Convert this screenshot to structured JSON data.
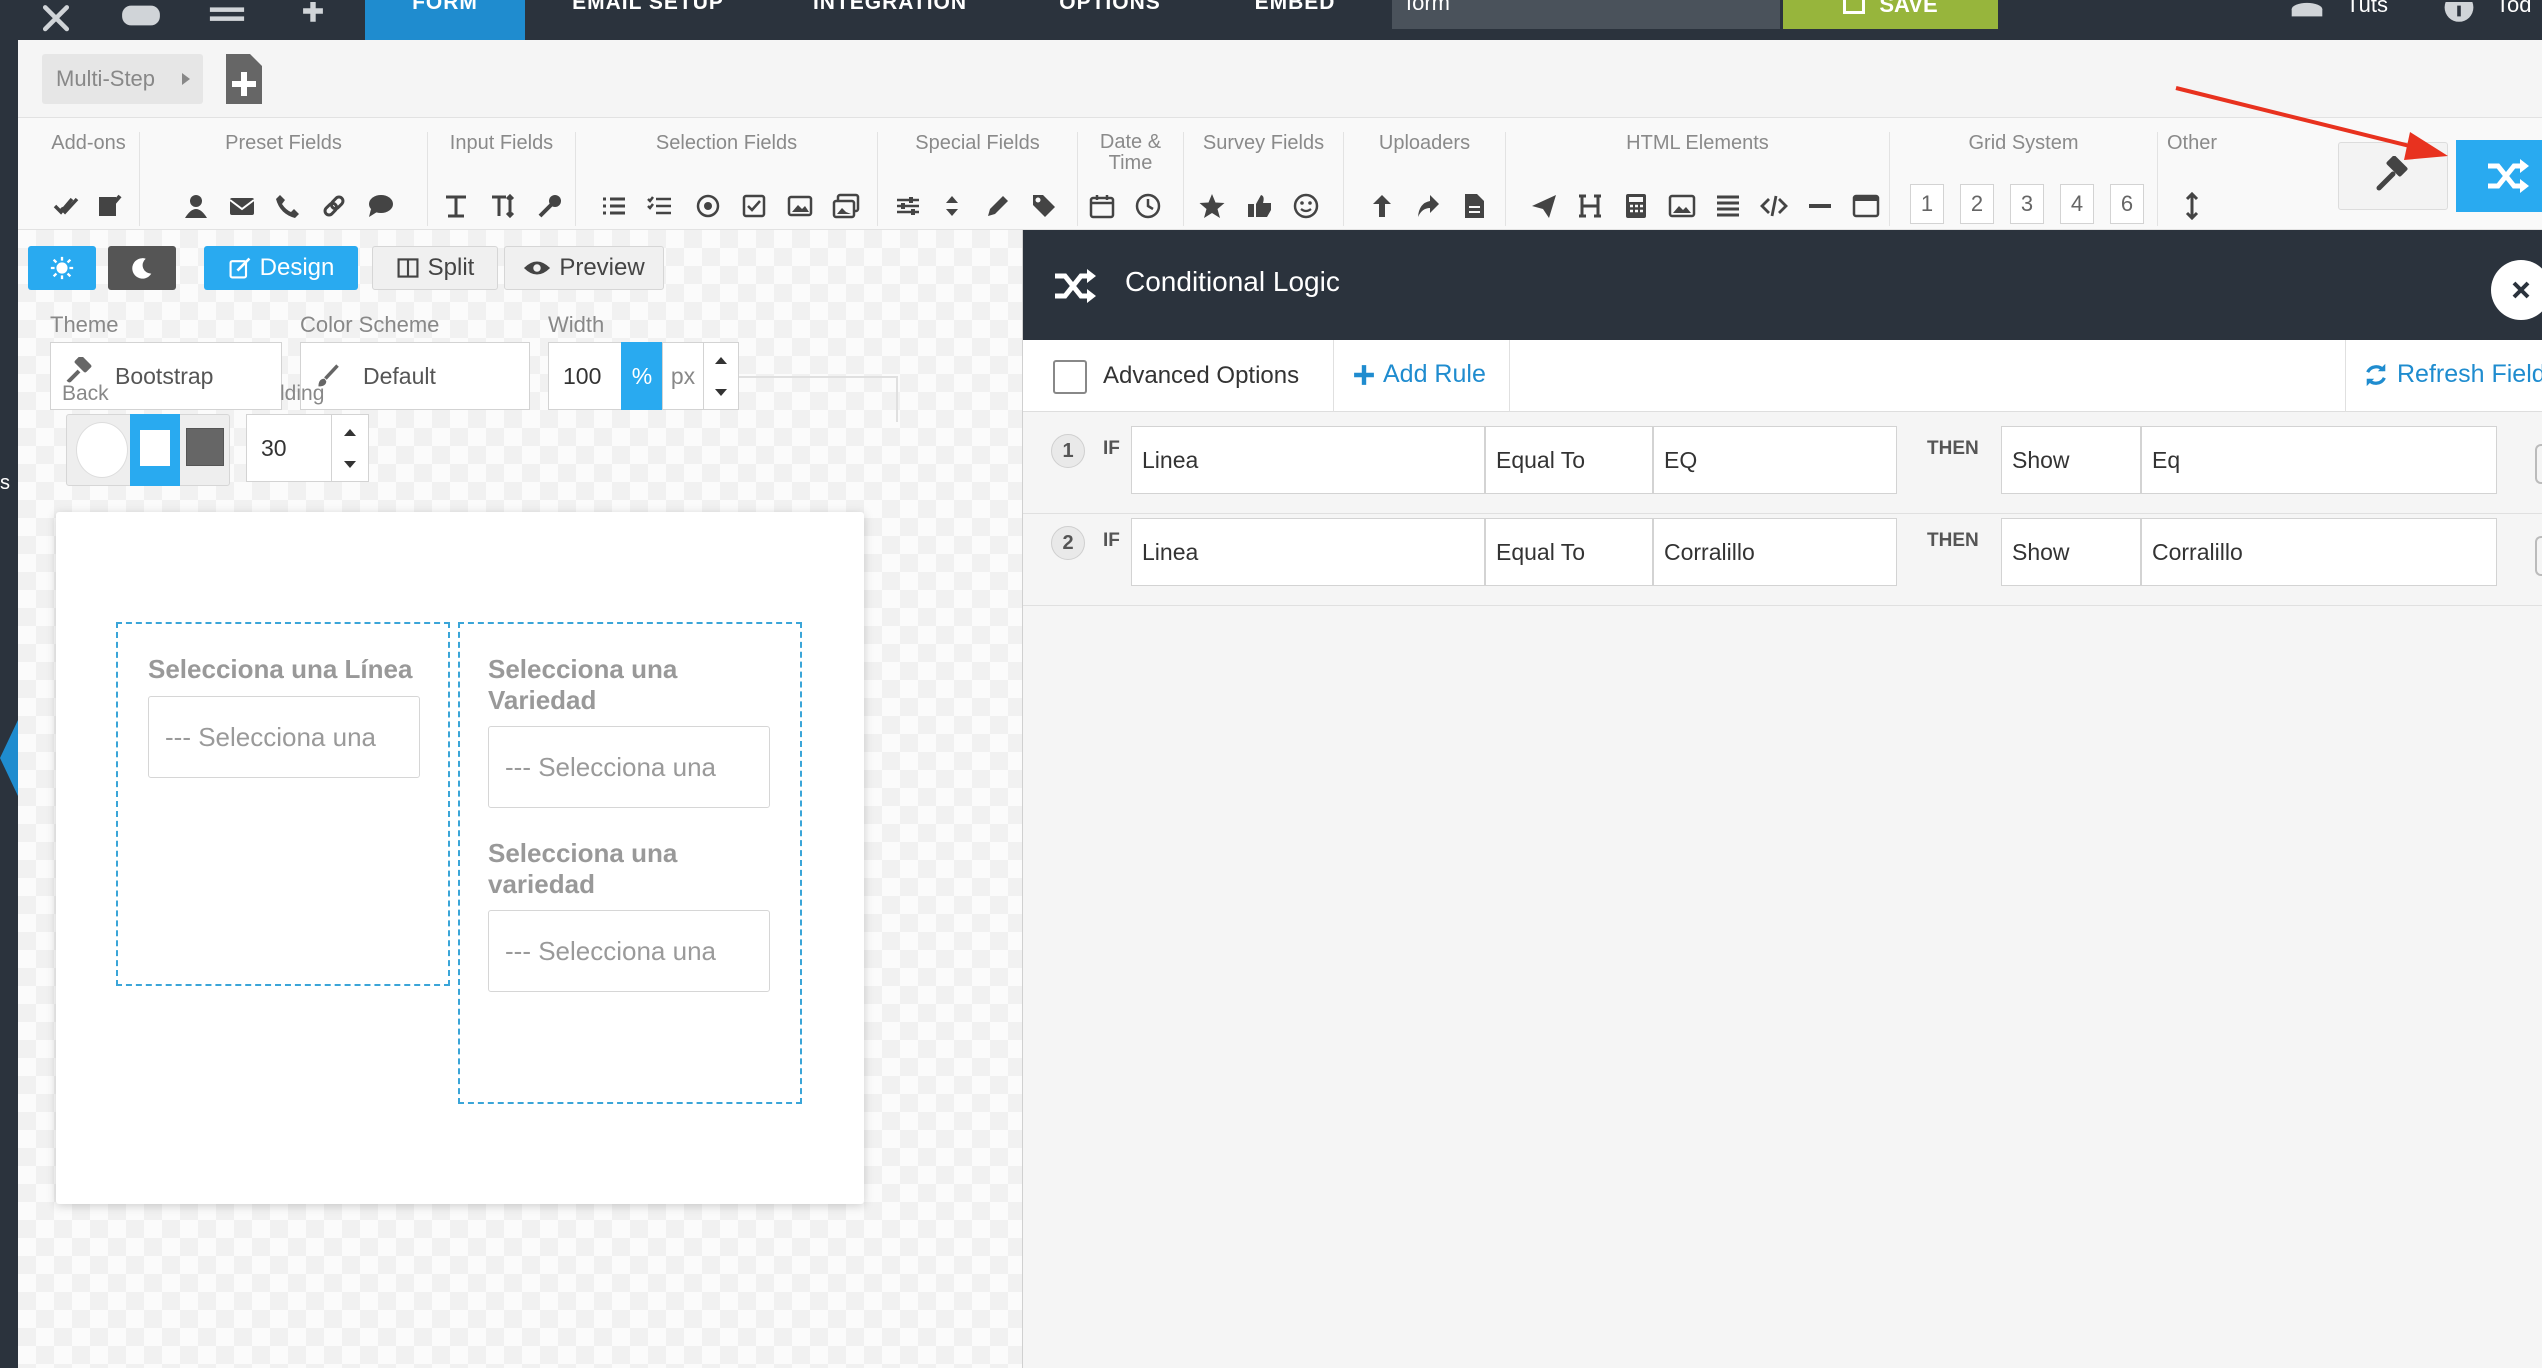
{
  "topnav": {
    "tabs": [
      {
        "label": "FORM",
        "active": true
      },
      {
        "label": "EMAIL SETUP",
        "active": false
      },
      {
        "label": "INTEGRATION",
        "active": false
      },
      {
        "label": "OPTIONS",
        "active": false
      },
      {
        "label": "EMBED",
        "active": false
      }
    ],
    "form_name_value": "form",
    "save_label": "SAVE",
    "user_links": [
      "Tuts",
      "Tod"
    ],
    "icons": [
      "tools-icon",
      "gamepad-icon",
      "menu-icon",
      "plus-icon",
      "database-icon",
      "info-icon",
      "save-icon"
    ]
  },
  "multistep": {
    "tab_label": "Multi-Step",
    "add_icon": "add-page-icon"
  },
  "toolbox": {
    "groups": [
      {
        "label": "Add-ons",
        "icons": [
          "check-double-icon",
          "edit-icon"
        ]
      },
      {
        "label": "Preset Fields",
        "icons": [
          "user-icon",
          "envelope-icon",
          "phone-icon",
          "link-icon",
          "comment-icon"
        ]
      },
      {
        "label": "Input Fields",
        "icons": [
          "text-icon",
          "text-height-icon",
          "key-icon"
        ]
      },
      {
        "label": "Selection Fields",
        "icons": [
          "list-icon",
          "checklist-icon",
          "radio-icon",
          "checkbox-icon",
          "image-icon",
          "images-icon"
        ]
      },
      {
        "label": "Special Fields",
        "icons": [
          "sliders-icon",
          "sort-icon",
          "pencil-icon",
          "tag-icon"
        ]
      },
      {
        "label": "Date & Time",
        "icons": [
          "calendar-icon",
          "clock-icon"
        ]
      },
      {
        "label": "Survey Fields",
        "icons": [
          "star-icon",
          "thumbs-up-icon",
          "smile-icon"
        ]
      },
      {
        "label": "Uploaders",
        "icons": [
          "upload-icon",
          "share-icon",
          "file-icon"
        ]
      },
      {
        "label": "HTML Elements",
        "icons": [
          "send-icon",
          "heading-icon",
          "calculator-icon",
          "picture-icon",
          "align-icon",
          "code-icon",
          "minus-icon",
          "window-icon"
        ]
      },
      {
        "label": "Grid System",
        "boxes": [
          "1",
          "2",
          "3",
          "4",
          "6"
        ]
      },
      {
        "label": "Other",
        "icons": [
          "resize-vertical-icon"
        ]
      }
    ],
    "hammer_icon": "gavel-icon",
    "logic_icon": "random-icon"
  },
  "designer": {
    "modes": {
      "design": "Design",
      "split": "Split",
      "preview": "Preview"
    },
    "theme_label": "Theme",
    "theme_value": "Bootstrap",
    "color_scheme_label": "Color Scheme",
    "color_scheme_value": "Default",
    "width_label": "Width",
    "width_value": "100",
    "unit_percent": "%",
    "unit_px": "px",
    "background_label_partial": "Back",
    "padding_label_partial": "lding",
    "padding_value": "30"
  },
  "form": {
    "col1": {
      "label": "Selecciona una Línea",
      "placeholder": "--- Selecciona una"
    },
    "col2": {
      "field1_label": "Selecciona una Variedad",
      "field1_placeholder": "--- Selecciona una",
      "field2_label": "Selecciona una variedad",
      "field2_placeholder": "--- Selecciona una"
    }
  },
  "logic_panel": {
    "title": "Conditional Logic",
    "advanced_options": "Advanced Options",
    "add_rule": "Add Rule",
    "refresh_fields": "Refresh Fields",
    "rules": [
      {
        "num": "1",
        "if": "IF",
        "field": "Linea",
        "operator": "Equal To",
        "value": "EQ",
        "then": "THEN",
        "action": "Show",
        "target": "Eq"
      },
      {
        "num": "2",
        "if": "IF",
        "field": "Linea",
        "operator": "Equal To",
        "value": "Corralillo",
        "then": "THEN",
        "action": "Show",
        "target": "Corralillo"
      }
    ]
  },
  "annotation_color": "#e8321f",
  "accent_color": "#29aaf0"
}
